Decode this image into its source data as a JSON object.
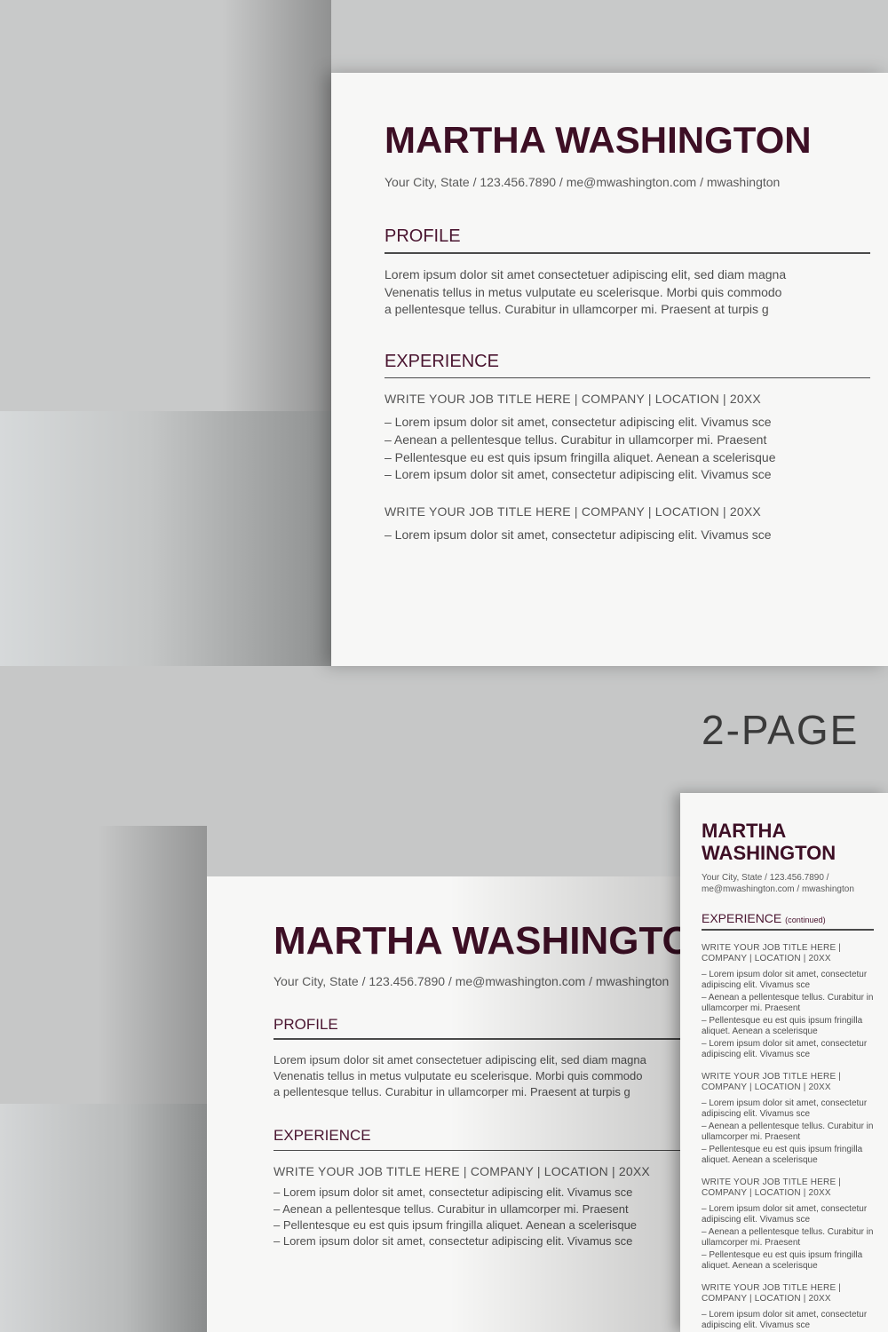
{
  "tagline": "2-PAGE",
  "accent_color": "#3d0f25",
  "resume": {
    "name": "MARTHA WASHINGTON",
    "contact": "Your City, State  /  123.456.7890  /  me@mwashington.com  /  mwashington",
    "profile_heading": "PROFILE",
    "profile_lines": [
      "Lorem ipsum dolor sit amet consectetuer adipiscing elit, sed diam magna",
      "Venenatis tellus in metus vulputate eu scelerisque. Morbi quis commodo",
      "a pellentesque tellus. Curabitur in ullamcorper mi. Praesent at turpis g"
    ],
    "experience_heading": "EXPERIENCE",
    "experience_cont_heading": "EXPERIENCE",
    "experience_cont_suffix": "(continued)",
    "job_title_line": "WRITE YOUR JOB TITLE HERE  |  COMPANY  |  LOCATION  |  20XX",
    "bullets": [
      "– Lorem ipsum dolor sit amet, consectetur adipiscing elit. Vivamus sce",
      "– Aenean a pellentesque tellus. Curabitur in ullamcorper mi. Praesent",
      "– Pellentesque eu est quis ipsum fringilla aliquet. Aenean a scelerisque",
      "– Lorem ipsum dolor sit amet, consectetur adipiscing elit. Vivamus sce"
    ]
  }
}
